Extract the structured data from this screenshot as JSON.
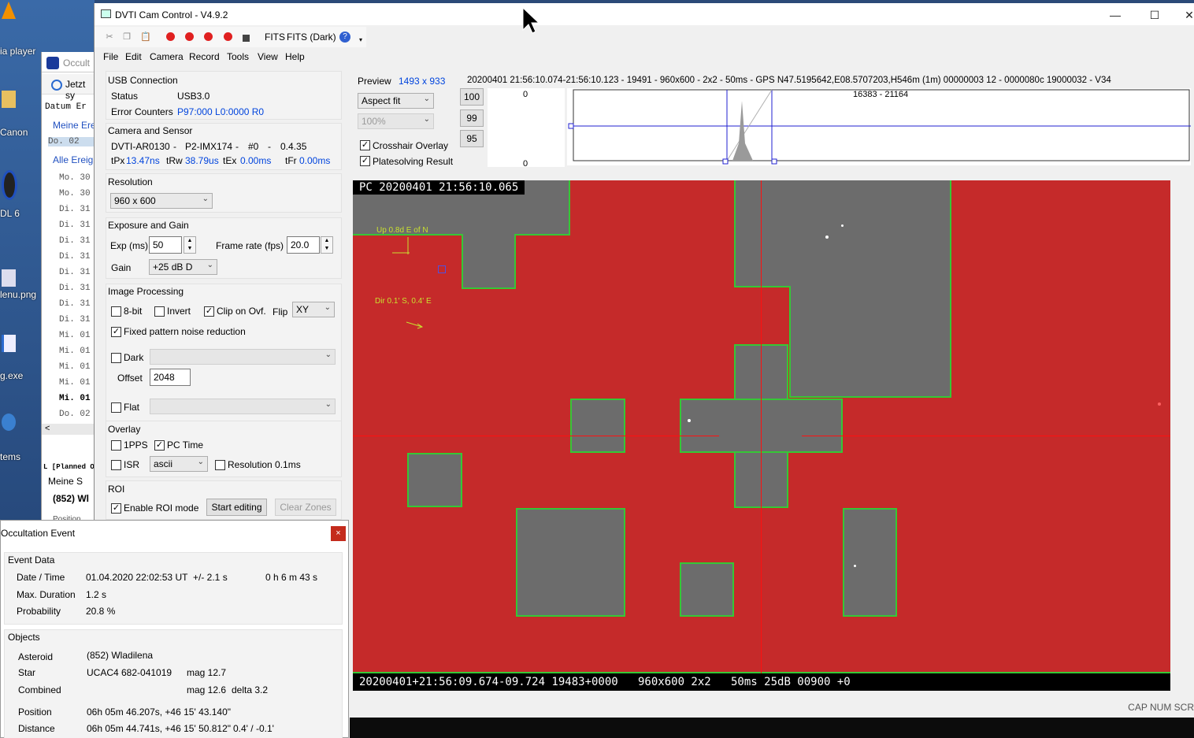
{
  "desktop": {
    "labels": [
      "ia player",
      "Canon",
      "DL 6",
      "lenu.png",
      "g.exe",
      "tems"
    ],
    "bg_window": {
      "title": "Occult",
      "today": "Jetzt sy",
      "col_header": "Datum Er",
      "my_events": "Meine Ere",
      "rows": [
        "Do. 02",
        "Alle Ereig",
        "Mo. 30",
        "Mo. 30",
        "Di. 31",
        "Di. 31",
        "Di. 31",
        "Di. 31",
        "Di. 31",
        "Di. 31",
        "Di. 31",
        "Di. 31",
        "Mi. 01",
        "Mi. 01",
        "Mi. 01",
        "Mi. 01",
        "Mi. 01",
        "Do. 02"
      ],
      "planned": "L [Planned Ob",
      "meine": "Meine S",
      "asteroid_short": "(852) Wl",
      "position_short": "Position"
    }
  },
  "window": {
    "title": "DVTI Cam Control - V4.9.2",
    "toolbar": {
      "fits": "FITS",
      "fits_dark": "FITS (Dark)"
    },
    "menu": [
      "File",
      "Edit",
      "Camera",
      "Record",
      "Tools",
      "View",
      "Help"
    ]
  },
  "panel": {
    "usb": {
      "heading": "USB Connection",
      "status_label": "Status",
      "status_value": "USB3.0",
      "errors_label": "Error Counters",
      "errors_value": "P97:000 L0:0000 R0"
    },
    "camera": {
      "heading": "Camera and Sensor",
      "model": "DVTI-AR0130",
      "sensor": "P2-IMX174",
      "index": "#0",
      "fw": "0.4.35",
      "sep": "-",
      "tpx_label": "tPx",
      "tpx_value": "13.47ns",
      "trw_label": "tRw",
      "trw_value": "38.79us",
      "tex_label": "tEx",
      "tex_value": "0.00ms",
      "tfr_label": "tFr",
      "tfr_value": "0.00ms"
    },
    "resolution": {
      "heading": "Resolution",
      "value": "960 x 600"
    },
    "exposure": {
      "heading": "Exposure and Gain",
      "exp_label": "Exp (ms)",
      "exp_value": "50",
      "fps_label": "Frame rate (fps)",
      "fps_value": "20.0",
      "gain_label": "Gain",
      "gain_value": "+25 dB D"
    },
    "processing": {
      "heading": "Image Processing",
      "bit8": "8-bit",
      "invert": "Invert",
      "clip": "Clip on Ovf.",
      "flip_label": "Flip",
      "flip_value": "XY",
      "fpn": "Fixed pattern noise reduction",
      "dark": "Dark",
      "offset_label": "Offset",
      "offset_value": "2048",
      "flat": "Flat"
    },
    "overlay": {
      "heading": "Overlay",
      "pps": "1PPS",
      "pctime": "PC Time",
      "isr": "ISR",
      "isr_value": "ascii",
      "res": "Resolution 0.1ms"
    },
    "roi": {
      "heading": "ROI",
      "enable": "Enable ROI mode",
      "start": "Start editing",
      "clear": "Clear Zones"
    }
  },
  "preview": {
    "label": "Preview",
    "size": "1493 x 933",
    "info": "20200401 21:56:10.074-21:56:10.123 - 19491 - 960x600 - 2x2 - 50ms - GPS N47.5195642,E08.5707203,H546m (1m) 00000003 12 - 0000080c 19000032 - V34",
    "fit": "Aspect fit",
    "zoom": "100%",
    "crosshair": "Crosshair Overlay",
    "platesolve": "Platesolving Result",
    "levels": [
      "100",
      "99",
      "95"
    ],
    "hist_top": "0",
    "hist_bottom": "0",
    "hist_range": "16383 - 21164"
  },
  "video": {
    "osd_top": "PC 20200401 21:56:10.065",
    "osd_bottom": "20200401+21:56:09.674-09.724 19483+0000   960x600 2x2   50ms 25dB 00900 +0",
    "ann_up": "Up 0.8d E of N",
    "ann_dir": "Dir 0.1' S, 0.4' E"
  },
  "status": {
    "cap": "CAP",
    "num": "NUM",
    "scr": "SCR"
  },
  "occultation": {
    "title": "Occultation Event",
    "close": "×",
    "event_heading": "Event Data",
    "date_label": "Date / Time",
    "date_value": "01.04.2020 22:02:53 UT",
    "date_err": "+/- 2.1 s",
    "countdown": "0 h 6 m 43 s",
    "dur_label": "Max. Duration",
    "dur_value": "1.2 s",
    "prob_label": "Probability",
    "prob_value": "20.8 %",
    "objects_heading": "Objects",
    "ast_label": "Asteroid",
    "ast_value": "(852) Wladilena",
    "star_label": "Star",
    "star_value": "UCAC4 682-041019",
    "star_mag": "mag 12.7",
    "comb_label": "Combined",
    "comb_mag": "mag 12.6",
    "comb_delta": "delta 3.2",
    "pos_label": "Position",
    "pos_value": "06h 05m 46.207s, +46 15' 43.140\"",
    "dist_label": "Distance",
    "dist_value": "06h 05m 44.741s, +46 15' 50.812\"",
    "dist_offset": "0.4' / -0.1'"
  },
  "colors": {
    "accent": "#0044dd",
    "video_red": "#c52a2a",
    "zone_green": "#36c736",
    "close_red": "#c42b1c"
  }
}
